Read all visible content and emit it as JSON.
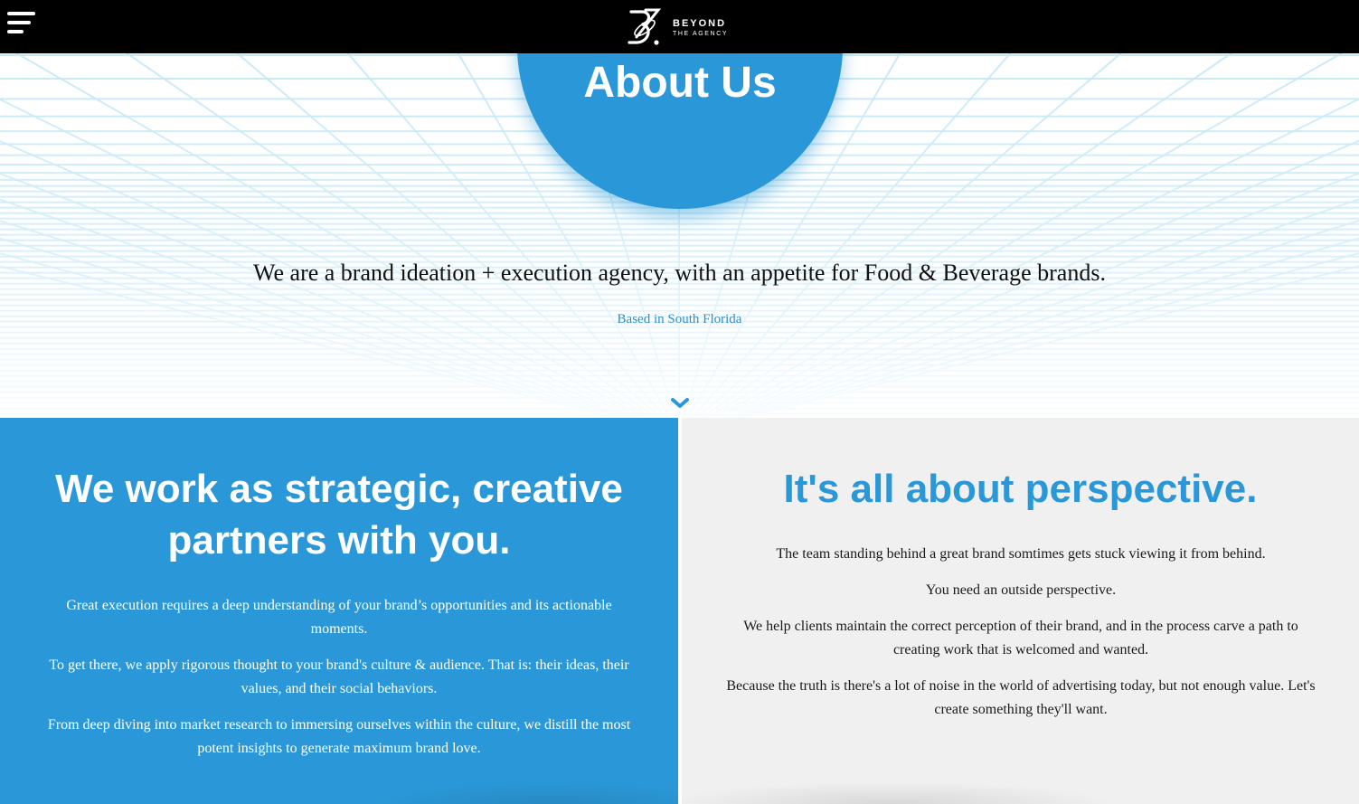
{
  "nav": {
    "brand_name": "BEYOND",
    "brand_sub": "THE AGENCY"
  },
  "hero": {
    "title": "About Us",
    "tagline": "We are a brand ideation + execution agency, with an appetite for Food & Beverage brands.",
    "location": "Based in South Florida"
  },
  "left_panel": {
    "title": "We work as strategic, creative partners with you.",
    "paragraphs": [
      "Great execution requires a deep understanding of your brand’s opportunities and its actionable moments.",
      "To get there, we apply rigorous thought to your brand's culture & audience. That is: their ideas, their values, and their social behaviors.",
      "From deep diving into market research to immersing ourselves within the culture, we distill the most potent insights to generate maximum brand love."
    ]
  },
  "right_panel": {
    "title": "It's all about perspective.",
    "paragraphs": [
      "The team standing behind a great brand somtimes gets stuck viewing it from behind.",
      "You need an outside perspective.",
      "We help clients maintain the correct perception of their brand, and in the process carve a path to creating work that is welcomed and wanted.",
      "Because the truth is there's a lot of noise in the world of advertising today, but not enough value. Let's create something they'll want."
    ]
  },
  "colors": {
    "accent_blue": "#2a98d8",
    "grid_line": "#bfe6f7",
    "panel_grey": "#f0f0f0",
    "nav_black": "#000000"
  },
  "icons": {
    "menu": "hamburger-menu-icon",
    "logo": "beyond-logo-mark",
    "scroll": "chevron-down-icon"
  }
}
